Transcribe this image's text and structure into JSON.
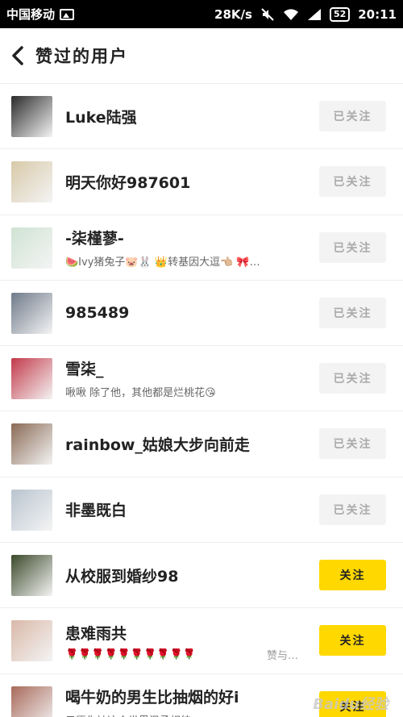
{
  "status_bar": {
    "carrier": "中国移动",
    "speed": "28K/s",
    "battery": "52",
    "time": "20:11"
  },
  "header": {
    "title": "赞过的用户"
  },
  "users": [
    {
      "name": "Luke陆强",
      "sub": "",
      "extra": "",
      "button": "已关注",
      "followed": true,
      "avatar_color": "#2b2b2b"
    },
    {
      "name": "明天你好987601",
      "sub": "",
      "extra": "",
      "button": "已关注",
      "followed": true,
      "avatar_color": "#d8c9a8"
    },
    {
      "name": "-柒槿蓼-",
      "sub": "🍉Ivy猪兔子🐷🐰 👑转基因大逗👈🏼 🎀…",
      "extra": "",
      "button": "已关注",
      "followed": true,
      "avatar_color": "#cfe3d3"
    },
    {
      "name": "985489",
      "sub": "",
      "extra": "",
      "button": "已关注",
      "followed": true,
      "avatar_color": "#6f7a8a"
    },
    {
      "name": "雪柒_",
      "sub": "啾啾        除了他，其他都是烂桃花😘",
      "extra": "",
      "button": "已关注",
      "followed": true,
      "avatar_color": "#c23a4a"
    },
    {
      "name": "rainbow_姑娘大步向前走",
      "sub": "",
      "extra": "",
      "button": "已关注",
      "followed": true,
      "avatar_color": "#8a6a55"
    },
    {
      "name": "非墨既白",
      "sub": "",
      "extra": "",
      "button": "已关注",
      "followed": true,
      "avatar_color": "#b9c4cf"
    },
    {
      "name": "从校服到婚纱98",
      "sub": "",
      "extra": "",
      "button": "关注",
      "followed": false,
      "avatar_color": "#3c4a2a"
    },
    {
      "name": "患难雨共",
      "sub": "🌹🌹🌹🌹🌹🌹🌹🌹🌹🌹",
      "extra": "赞与…",
      "button": "关注",
      "followed": false,
      "avatar_color": "#d9b8a8"
    },
    {
      "name": "喝牛奶的男生比抽烟的好i",
      "sub": "只愿你被这个世界温柔相待❤❤❤",
      "extra": "",
      "button": "关注",
      "followed": false,
      "avatar_color": "#a86a5a"
    }
  ],
  "watermark": "Baidu经验"
}
